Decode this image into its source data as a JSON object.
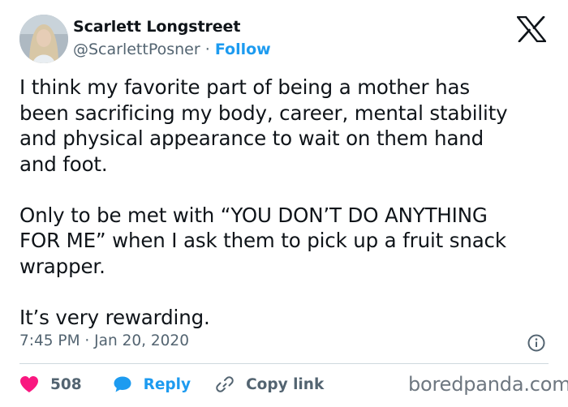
{
  "author": {
    "name": "Scarlett Longstreet",
    "handle": "@ScarlettPosner",
    "separator": "·",
    "follow_label": "Follow"
  },
  "tweet": {
    "text": "I think my favorite part of being a mother has\nbeen sacrificing my body, career, mental stability\nand physical appearance to wait on them hand\nand foot.\n\nOnly to be met with “YOU DON’T DO ANYTHING\nFOR ME” when I ask them to pick up a fruit snack\nwrapper.\n\nIt’s very rewarding.",
    "timestamp": "7:45 PM · Jan 20, 2020"
  },
  "actions": {
    "likes": "508",
    "reply_label": "Reply",
    "copy_label": "Copy link"
  },
  "watermark": "boredpanda.com",
  "icons": {
    "logo": "x-logo-icon",
    "info": "info-icon",
    "like": "heart-icon",
    "reply": "speech-bubble-icon",
    "copy": "link-icon"
  },
  "colors": {
    "accent": "#1d9bf0",
    "heart": "#f91880",
    "secondary_text": "#536471",
    "primary_text": "#0f1419",
    "divider": "#cfd9de"
  }
}
